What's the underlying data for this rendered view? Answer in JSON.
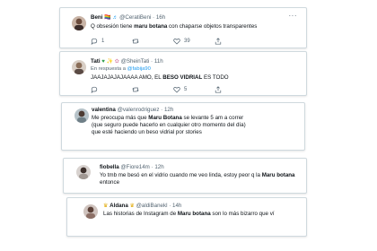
{
  "tweets": [
    {
      "name": "Beni",
      "handle": "@CeratiBeni",
      "time": "16h",
      "body_pre": "Q obsesión tiene ",
      "body_bold": "maru botana",
      "body_post": " con chaparse objetos transparentes",
      "counts": {
        "reply": "1",
        "retweet": "",
        "like": "39"
      }
    },
    {
      "name": "Tati",
      "handle": "@SheinTati",
      "time": "11h",
      "reply_label": "En respuesta a",
      "reply_handle": "@fabija90",
      "body_pre": "JAAJAJAJAJAAAA AMO, EL ",
      "body_bold": "BESO VIDRIAL",
      "body_post": " ES TODO",
      "counts": {
        "reply": "",
        "retweet": "",
        "like": "5"
      }
    },
    {
      "name": "valentina",
      "handle": "@valenrodriguez",
      "time": "12h",
      "body_pre": "Me preocupa más que ",
      "body_bold": "Maru Botana",
      "body_post": " se levante 5 am a correr (que seguro puede hacerlo en cualquier otro momento del día) que esté haciendo un beso vidrial por stories"
    },
    {
      "name": "fiobella",
      "handle": "@Fiore14m",
      "time": "12h",
      "body_pre": "Yo tmb me besó en el vidrio cuando me veo linda, estoy peor q la ",
      "body_bold": "Maru botana",
      "body_post": " entonce"
    },
    {
      "name": "Aldana",
      "handle": "@aldiBanekl",
      "time": "14h",
      "body_pre": "Las historias de Instagram de ",
      "body_bold": "Maru botana",
      "body_post": " son lo más bizarro que ví"
    }
  ],
  "separator": "·",
  "more_label": "···",
  "colors": {
    "accent": "#1d9bf0",
    "muted": "#536471",
    "border": "#cfd9de"
  },
  "icons": [
    "reply-icon",
    "retweet-icon",
    "like-icon",
    "share-icon",
    "more-icon"
  ]
}
